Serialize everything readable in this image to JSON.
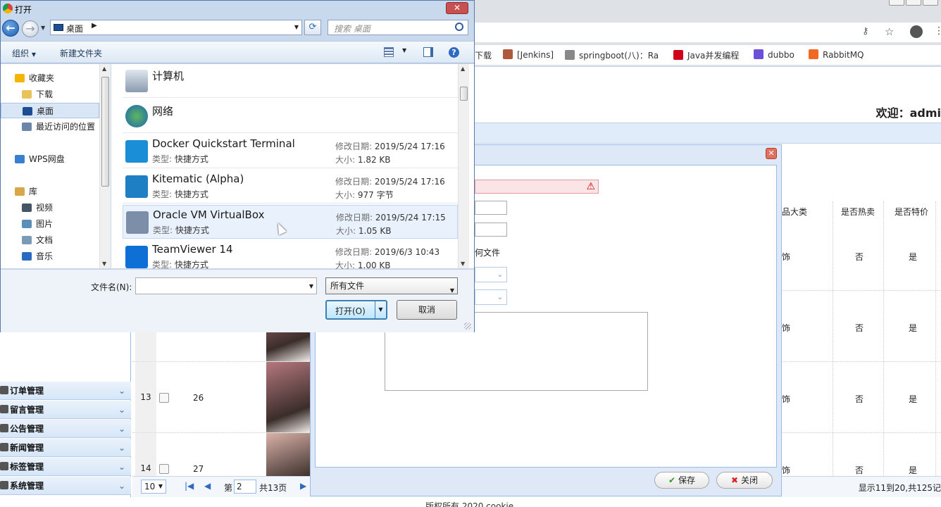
{
  "browser": {
    "bookmarks": [
      {
        "label": "下载",
        "color": "#555555"
      },
      {
        "label": "[Jenkins]",
        "color": "#b05a3c"
      },
      {
        "label": "springboot(八)：Ra",
        "color": "#888888"
      },
      {
        "label": "Java并发编程",
        "color": "#d0021b"
      },
      {
        "label": "dubbo",
        "color": "#6b4fd8"
      },
      {
        "label": "RabbitMQ",
        "color": "#f26822"
      }
    ]
  },
  "app": {
    "welcome": "欢迎：admi",
    "footer": "版权所有 2020 cookie",
    "sidebar": [
      {
        "label": "订单管理",
        "icon": "order-icon"
      },
      {
        "label": "留言管理",
        "icon": "message-icon"
      },
      {
        "label": "公告管理",
        "icon": "notice-icon"
      },
      {
        "label": "新闻管理",
        "icon": "news-icon"
      },
      {
        "label": "标签管理",
        "icon": "tag-icon"
      },
      {
        "label": "系统管理",
        "icon": "system-icon"
      }
    ],
    "grid": {
      "headers": [
        "品大类",
        "是否热卖",
        "是否特价"
      ],
      "rows": [
        {
          "num": "",
          "id": "",
          "cat": "饰",
          "hot": "否",
          "sale": "是"
        },
        {
          "num": "",
          "id": "",
          "cat": "饰",
          "hot": "否",
          "sale": "是"
        },
        {
          "num": "13",
          "id": "26",
          "cat": "饰",
          "hot": "否",
          "sale": "是"
        },
        {
          "num": "14",
          "id": "27",
          "cat": "饰",
          "hot": "否",
          "sale": "是"
        }
      ]
    },
    "pager": {
      "page_size": "10",
      "page_prefix": "第",
      "page_value": "2",
      "page_total": "共13页",
      "summary": "显示11到20,共125记"
    },
    "edit_dialog": {
      "partial_label": "何文件",
      "save": "保存",
      "close": "关闭"
    }
  },
  "open_dialog": {
    "title": "打开",
    "address": "桌面",
    "search_placeholder": "搜索 桌面",
    "organize": "组织",
    "new_folder": "新建文件夹",
    "nav": [
      {
        "label": "收藏夹",
        "icon": "star-icon",
        "top": true
      },
      {
        "label": "下载",
        "icon": "folder-icon"
      },
      {
        "label": "桌面",
        "icon": "desktop-icon",
        "selected": true
      },
      {
        "label": "最近访问的位置",
        "icon": "recent-icon"
      },
      {
        "label": "WPS网盘",
        "icon": "cloud-icon",
        "top": true
      },
      {
        "label": "库",
        "icon": "library-icon",
        "top": true
      },
      {
        "label": "视频",
        "icon": "video-icon"
      },
      {
        "label": "图片",
        "icon": "picture-icon"
      },
      {
        "label": "文档",
        "icon": "document-icon"
      },
      {
        "label": "音乐",
        "icon": "music-icon"
      }
    ],
    "system_items": [
      {
        "name": "计算机",
        "icon": "computer-icon"
      },
      {
        "name": "网络",
        "icon": "network-icon"
      }
    ],
    "files": [
      {
        "name": "Docker Quickstart Terminal",
        "type_label": "类型:",
        "type": "快捷方式",
        "mod_label": "修改日期:",
        "modified": "2019/5/24 17:16",
        "size_label": "大小:",
        "size": "1.82 KB",
        "color": "#1a8fd8"
      },
      {
        "name": "Kitematic (Alpha)",
        "type_label": "类型:",
        "type": "快捷方式",
        "mod_label": "修改日期:",
        "modified": "2019/5/24 17:16",
        "size_label": "大小:",
        "size": "977 字节",
        "color": "#1f7fc4"
      },
      {
        "name": "Oracle VM VirtualBox",
        "type_label": "类型:",
        "type": "快捷方式",
        "mod_label": "修改日期:",
        "modified": "2019/5/24 17:15",
        "size_label": "大小:",
        "size": "1.05 KB",
        "color": "#7d8ea8"
      },
      {
        "name": "TeamViewer 14",
        "type_label": "类型:",
        "type": "快捷方式",
        "mod_label": "修改日期:",
        "modified": "2019/6/3 10:43",
        "size_label": "大小:",
        "size": "1.00 KB",
        "color": "#0e6fd6"
      }
    ],
    "filename_label": "文件名(N):",
    "filename_value": "",
    "filter": "所有文件",
    "open_btn": "打开(O)",
    "cancel_btn": "取消"
  }
}
